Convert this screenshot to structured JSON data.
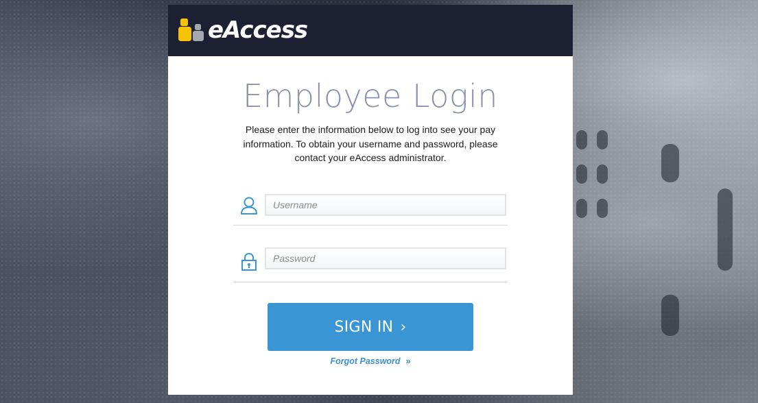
{
  "header": {
    "logo_text": "eAccess"
  },
  "login": {
    "title": "Employee Login",
    "description": "Please enter the information below to log into see your pay information. To obtain your username and password, please contact your eAccess administrator.",
    "username_placeholder": "Username",
    "username_value": "",
    "password_placeholder": "Password",
    "password_value": "",
    "signin_label": "SIGN IN",
    "signin_chevron": "›",
    "forgot_label": "Forgot Password",
    "forgot_chevron": "»"
  },
  "icons": {
    "logo": "people-icon",
    "username": "user-icon",
    "password": "lock-icon"
  },
  "colors": {
    "header_bg": "#1d1f33",
    "accent": "#3a95d4",
    "title": "#8a92ad",
    "logo_yellow": "#f5c400",
    "logo_gray": "#a6a8b0"
  }
}
